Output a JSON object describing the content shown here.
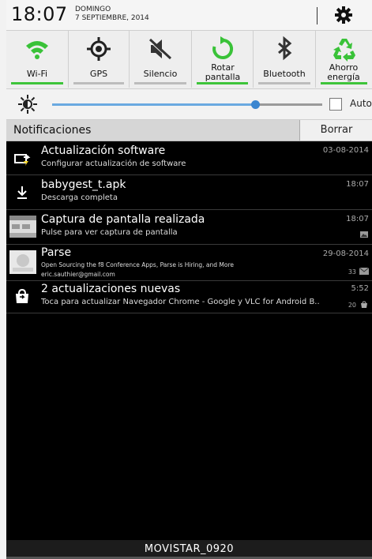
{
  "status": {
    "time": "18:07",
    "day": "DOMINGO",
    "date": "7 SEPTIEMBRE, 2014"
  },
  "toggles": [
    {
      "label": "Wi-Fi",
      "icon": "wifi-icon",
      "active": true
    },
    {
      "label": "GPS",
      "icon": "gps-icon",
      "active": false
    },
    {
      "label": "Silencio",
      "icon": "mute-icon",
      "active": false
    },
    {
      "label": "Rotar pantalla",
      "icon": "rotate-icon",
      "active": true
    },
    {
      "label": "Bluetooth",
      "icon": "bluetooth-icon",
      "active": false
    },
    {
      "label": "Ahorro energía",
      "icon": "power-saving-icon",
      "active": true
    }
  ],
  "brightness": {
    "level": 0.75,
    "auto_label": "Auto"
  },
  "notifications": {
    "title": "Notificaciones",
    "clear_label": "Borrar",
    "items": [
      {
        "title": "Actualización software",
        "subtitle": "Configurar actualización de software",
        "date": "03-08-2014",
        "icon": "software-update-icon"
      },
      {
        "title": "babygest_t.apk",
        "subtitle": "Descarga completa",
        "date": "18:07",
        "icon": "download-icon"
      },
      {
        "title": "Captura de pantalla realizada",
        "subtitle": "Pulse para ver captura de pantalla",
        "date": "18:07",
        "icon": "screenshot-thumbnail"
      },
      {
        "title": "Parse",
        "subtitle": "Open Sourcing the f8 Conference Apps, Parse is Hiring, and More",
        "subtitle2": "eric.sauthier@gmail.com",
        "date": "29-08-2014",
        "count": "33",
        "icon": "mail-thumbnail"
      },
      {
        "title": "2 actualizaciones nuevas",
        "subtitle": "Toca para actualizar Navegador Chrome - Google y VLC for Android B..",
        "date": "5:52",
        "count": "20",
        "icon": "store-update-icon"
      }
    ]
  },
  "footer": {
    "carrier": "MOVISTAR_0920"
  },
  "colors": {
    "accent_green": "#3ec43a",
    "slider_blue": "#3b86d0"
  }
}
